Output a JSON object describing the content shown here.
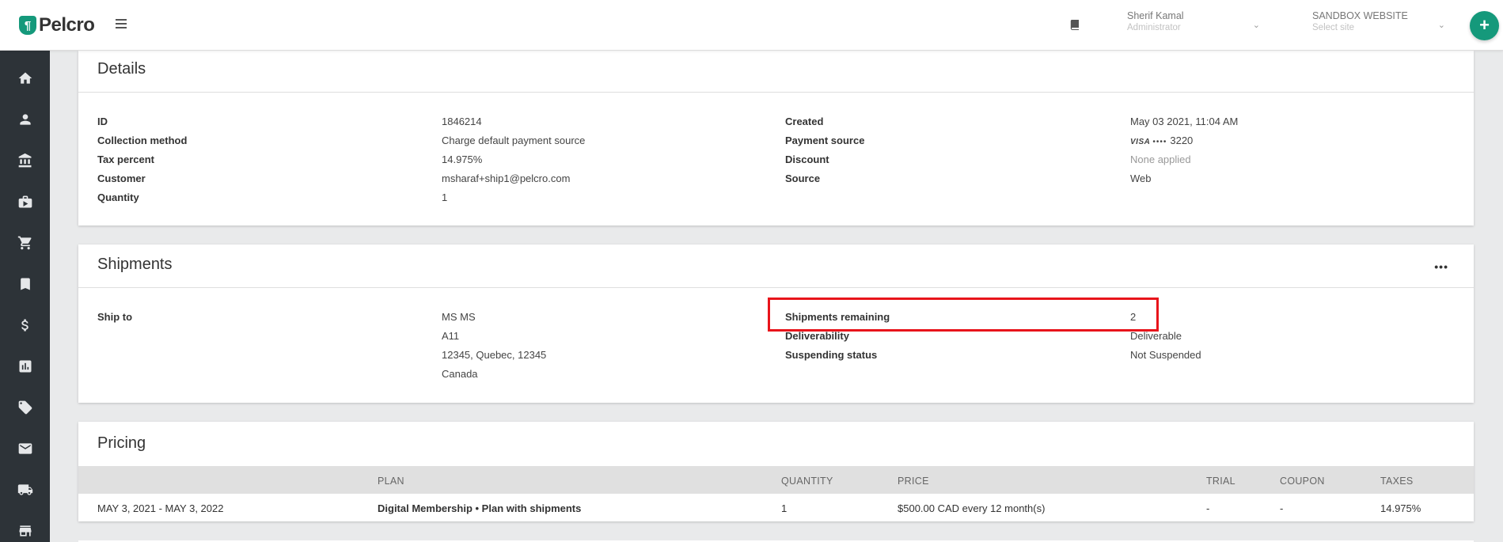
{
  "header": {
    "logo_text": "Pelcro",
    "logo_mark": "¶",
    "user_name": "Sherif Kamal",
    "user_role": "Administrator",
    "site_name": "SANDBOX WEBSITE",
    "site_placeholder": "Select site",
    "plus_label": "+"
  },
  "sidebar": {
    "items": [
      "home-icon",
      "user-icon",
      "bank-icon",
      "briefcase-icon",
      "cart-icon",
      "bookmark-icon",
      "dollar-icon",
      "chart-icon",
      "ticket-icon",
      "mail-icon",
      "truck-icon",
      "store-icon"
    ]
  },
  "details": {
    "title": "Details",
    "id_label": "ID",
    "id_value": "1846214",
    "collection_label": "Collection method",
    "collection_value": "Charge default payment source",
    "tax_label": "Tax percent",
    "tax_value": "14.975%",
    "customer_label": "Customer",
    "customer_value": "msharaf+ship1@pelcro.com",
    "quantity_label": "Quantity",
    "quantity_value": "1",
    "created_label": "Created",
    "created_value": "May 03 2021, 11:04 AM",
    "payment_label": "Payment source",
    "payment_brand": "VISA",
    "payment_dots": "••••",
    "payment_last4": "3220",
    "discount_label": "Discount",
    "discount_value": "None applied",
    "source_label": "Source",
    "source_value": "Web"
  },
  "shipments": {
    "title": "Shipments",
    "more_label": "•••",
    "ship_to_label": "Ship to",
    "address_lines": [
      "MS MS",
      "A11",
      "12345, Quebec, 12345",
      "Canada"
    ],
    "remaining_label": "Shipments remaining",
    "remaining_value": "2",
    "deliverability_label": "Deliverability",
    "deliverability_value": "Deliverable",
    "suspending_label": "Suspending status",
    "suspending_value": "Not Suspended"
  },
  "pricing": {
    "title": "Pricing",
    "columns": [
      "PLAN",
      "QUANTITY",
      "PRICE",
      "TRIAL",
      "COUPON",
      "TAXES"
    ],
    "row": {
      "period": "MAY 3, 2021 - MAY 3, 2022",
      "plan": "Digital Membership • Plan with shipments",
      "quantity": "1",
      "price": "$500.00 CAD every 12 month(s)",
      "trial": "-",
      "coupon": "-",
      "taxes": "14.975%"
    }
  },
  "colors": {
    "brand": "#15997b",
    "sidebar": "#2d3338",
    "highlight": "#e8141b"
  }
}
